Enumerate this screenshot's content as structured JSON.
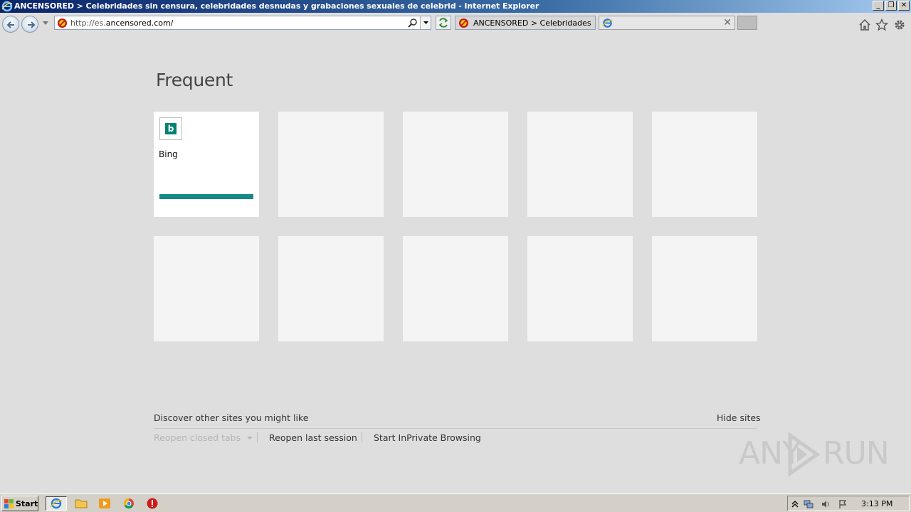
{
  "window": {
    "title": "ANCENSORED > Celebridades sin censura, celebridades desnudas y grabaciones sexuales de celebrid - Internet Explorer",
    "controls": [
      "_",
      "❐",
      "✕"
    ]
  },
  "addressbar": {
    "url_prefix": "http://es.",
    "url_domain": "ancensored.com/"
  },
  "tabs": [
    {
      "label": "ANCENSORED > Celebridades si...",
      "icon": "blocked-icon",
      "active": false
    },
    {
      "label": "",
      "icon": "ie-icon",
      "active": true,
      "close": "✕"
    }
  ],
  "page": {
    "heading": "Frequent",
    "tiles": [
      {
        "label": "Bing",
        "favicon_letter": "b",
        "favicon_color": "#008373",
        "usage": 1.0
      },
      {
        "label": ""
      },
      {
        "label": ""
      },
      {
        "label": ""
      },
      {
        "label": ""
      },
      {
        "label": ""
      },
      {
        "label": ""
      },
      {
        "label": ""
      },
      {
        "label": ""
      },
      {
        "label": ""
      }
    ],
    "discover_text": "Discover other sites you might like",
    "hide_sites": "Hide sites",
    "reopen_closed_tabs": "Reopen closed tabs",
    "reopen_last_session": "Reopen last session",
    "start_inprivate": "Start InPrivate Browsing"
  },
  "watermark": {
    "left": "ANY",
    "right": "RUN"
  },
  "taskbar": {
    "start_label": "Start",
    "apps": [
      "ie-icon",
      "explorer-icon",
      "media-player-icon",
      "chrome-icon",
      "opera-icon"
    ],
    "clock": "3:13 PM"
  },
  "colors": {
    "accent": "#158a85",
    "bing": "#008373",
    "titlebar": "#0a246a"
  }
}
